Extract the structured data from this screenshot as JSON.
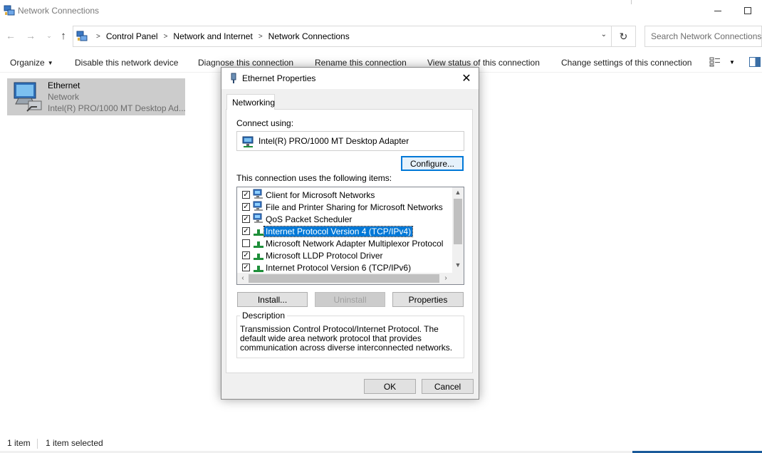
{
  "window": {
    "title": "Network Connections"
  },
  "address": {
    "crumbs": [
      "Control Panel",
      "Network and Internet",
      "Network Connections"
    ],
    "search_placeholder": "Search Network Connections"
  },
  "commands": {
    "organize": "Organize",
    "disable": "Disable this network device",
    "diagnose": "Diagnose this connection",
    "rename": "Rename this connection",
    "view_status": "View status of this connection",
    "change_settings": "Change settings of this connection"
  },
  "connection": {
    "name": "Ethernet",
    "type": "Network",
    "adapter": "Intel(R) PRO/1000 MT Desktop Ad..."
  },
  "status": {
    "count": "1 item",
    "selected": "1 item selected"
  },
  "dialog": {
    "title": "Ethernet Properties",
    "tab": "Networking",
    "connect_using_label": "Connect using:",
    "adapter_name": "Intel(R) PRO/1000 MT Desktop Adapter",
    "configure_label": "Configure...",
    "items_label": "This connection uses the following items:",
    "items": [
      {
        "label": "Client for Microsoft Networks",
        "checked": true,
        "icon": "network-client-icon"
      },
      {
        "label": "File and Printer Sharing for Microsoft Networks",
        "checked": true,
        "icon": "network-service-icon"
      },
      {
        "label": "QoS Packet Scheduler",
        "checked": true,
        "icon": "network-service-icon"
      },
      {
        "label": "Internet Protocol Version 4 (TCP/IPv4)",
        "checked": true,
        "icon": "protocol-icon",
        "selected": true
      },
      {
        "label": "Microsoft Network Adapter Multiplexor Protocol",
        "checked": false,
        "icon": "protocol-icon"
      },
      {
        "label": "Microsoft LLDP Protocol Driver",
        "checked": true,
        "icon": "protocol-icon"
      },
      {
        "label": "Internet Protocol Version 6 (TCP/IPv6)",
        "checked": true,
        "icon": "protocol-icon"
      }
    ],
    "install_label": "Install...",
    "uninstall_label": "Uninstall",
    "properties_label": "Properties",
    "description_legend": "Description",
    "description_text": "Transmission Control Protocol/Internet Protocol. The default wide area network protocol that provides communication across diverse interconnected networks.",
    "ok_label": "OK",
    "cancel_label": "Cancel",
    "close_glyph": "✕"
  },
  "colors": {
    "selection": "#0078d7",
    "selected_item_bg": "#cccccc",
    "dialog_bg": "#f0f0f0"
  }
}
